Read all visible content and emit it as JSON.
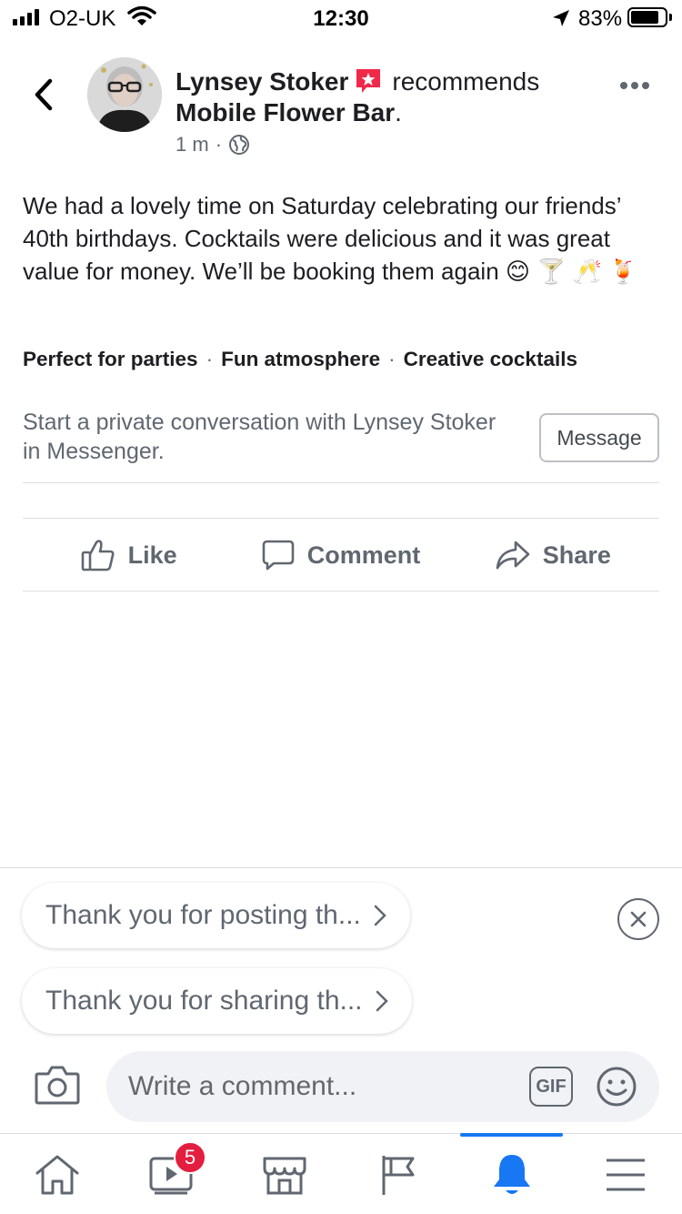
{
  "status_bar": {
    "carrier": "O2-UK",
    "time": "12:30",
    "battery_percent": "83%",
    "battery_level": 0.83,
    "icons": [
      "signal-icon",
      "wifi-icon",
      "location-arrow-icon",
      "battery-icon"
    ]
  },
  "header": {
    "author": "Lynsey Stoker",
    "action": "recommends",
    "page": "Mobile Flower Bar",
    "page_suffix": ".",
    "timestamp": "1 m",
    "separator": "·",
    "privacy_icon": "globe-icon"
  },
  "post": {
    "text": "We had a lovely time on Saturday celebrating our friends’ 40th birthdays. Cocktails were delicious and it was great value for money. We’ll be booking them again",
    "emojis": "😊 🍸 🥂 🍹",
    "tags": [
      "Perfect for parties",
      "Fun atmosphere",
      "Creative cocktails"
    ]
  },
  "messenger": {
    "prompt": "Start a private conversation with Lynsey Stoker in Messenger.",
    "button": "Message"
  },
  "actions": {
    "like": "Like",
    "comment": "Comment",
    "share": "Share"
  },
  "suggestions": [
    "Thank you for posting th...",
    "Thank you for sharing th..."
  ],
  "composer": {
    "placeholder": "Write a comment...",
    "gif_label": "GIF"
  },
  "tabbar": {
    "watch_badge": "5",
    "active_tab": "notifications",
    "accent_color": "#1877f2",
    "tabs": [
      "home-icon",
      "watch-icon",
      "marketplace-icon",
      "pages-flag-icon",
      "notifications-bell-icon",
      "menu-icon"
    ]
  }
}
